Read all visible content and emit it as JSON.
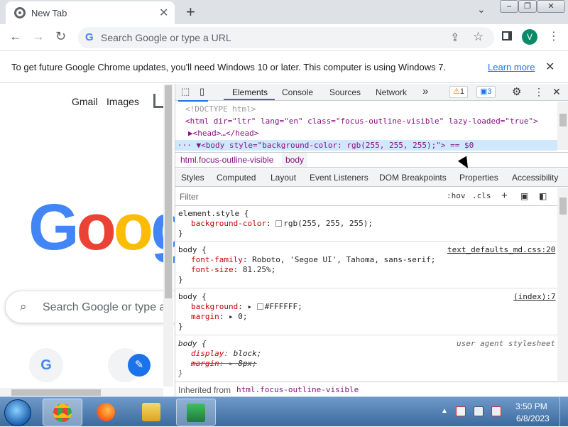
{
  "browser": {
    "tab_title": "New Tab",
    "tab_close": "✕",
    "new_tab": "+",
    "tab_search": "⌄",
    "window_controls": {
      "minimize": "–",
      "maximize": "❐",
      "close": "✕"
    },
    "nav": {
      "back": "←",
      "forward": "→",
      "reload": "↻"
    },
    "omnibox_placeholder": "Search Google or type a URL",
    "profile_initial": "V",
    "menu": "⋮"
  },
  "infobar": {
    "text": "To get future Google Chrome updates, you'll need Windows 10 or later. This computer is using Windows 7.",
    "link": "Learn more",
    "close": "✕"
  },
  "newtab_page": {
    "links": [
      "Gmail",
      "Images"
    ],
    "logo_letters": [
      "G",
      "o",
      "o",
      "g"
    ],
    "logo_colors": [
      "#4285f4",
      "#ea4335",
      "#fbbc05",
      "#4285f4"
    ],
    "search_placeholder": "Search Google or type a",
    "shortcut_initial": "G",
    "edit_icon": "✎"
  },
  "devtools": {
    "tabs": [
      "Elements",
      "Console",
      "Sources",
      "Network"
    ],
    "more_tabs": "»",
    "warnings_count": "1",
    "messages_count": "3",
    "dom_lines": [
      "<!DOCTYPE html>",
      "<html dir=\"ltr\" lang=\"en\" class=\"focus-outline-visible\" lazy-loaded=\"true\">",
      "▶<head>…</head>",
      "··· ▼<body style=\"background-color: rgb(255, 255, 255);\"> == $0"
    ],
    "breadcrumbs": [
      "html.focus-outline-visible",
      "body"
    ],
    "sub_tabs": [
      "Styles",
      "Computed",
      "Layout",
      "Event Listeners",
      "DOM Breakpoints",
      "Properties",
      "Accessibility"
    ],
    "filter_placeholder": "Filter",
    "hov": ":hov",
    "cls": ".cls",
    "rules": {
      "element_style": {
        "selector": "element.style {",
        "prop": "background-color",
        "value": "rgb(255, 255, 255);",
        "close": "}"
      },
      "body1": {
        "selector": "body {",
        "source": "text_defaults_md.css:20",
        "p1": "font-family",
        "v1": "Roboto, 'Segoe UI', Tahoma, sans-serif;",
        "p2": "font-size",
        "v2": "81.25%;",
        "close": "}"
      },
      "body2": {
        "selector": "body {",
        "source": "(index):7",
        "p1": "background",
        "v1": "#FFFFFF;",
        "p2": "margin",
        "v2": "0;",
        "close": "}"
      },
      "body3": {
        "selector": "body {",
        "source": "user agent stylesheet",
        "p1": "display",
        "v1": "block;",
        "p2": "margin",
        "v2": "8px;",
        "close": "}"
      }
    },
    "inherited_label": "Inherited from",
    "inherited_selector": "html.focus-outline-visible"
  },
  "taskbar": {
    "time": "3:50 PM",
    "date": "6/8/2023",
    "tray_up": "▲"
  }
}
